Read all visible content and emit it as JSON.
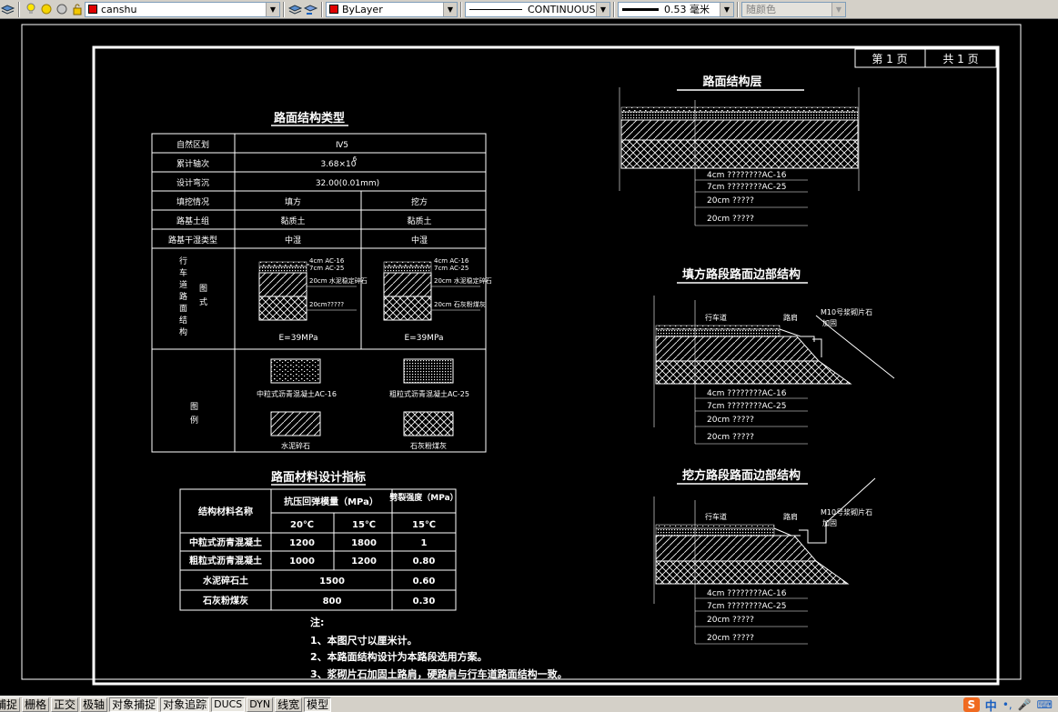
{
  "toolbar": {
    "layer_name": "canshu",
    "color_value": "ByLayer",
    "linetype_value": "CONTINUOUS",
    "lineweight_value": "0.53 毫米",
    "plotstyle_value": "随颜色"
  },
  "title_block": {
    "page": "第 1 页",
    "total": "共 1 页"
  },
  "pavement_type": {
    "title": "路面结构类型",
    "rows": [
      {
        "label": "自然区划",
        "value": "Ⅳ5"
      },
      {
        "label": "累计轴次",
        "value": "3.68×10",
        "sup": "6"
      },
      {
        "label": "设计弯沉",
        "value": "32.00(0.01mm)"
      }
    ],
    "fill_cut": {
      "label": "填挖情况",
      "fill": "填方",
      "cut": "挖方"
    },
    "soil": {
      "label": "路基土组",
      "fill": "黏质土",
      "cut": "黏质土"
    },
    "moisture": {
      "label": "路基干湿类型",
      "fill": "中湿",
      "cut": "中湿"
    },
    "diagram_label_left": "行车道路面结构",
    "diagram_label_right": "图式",
    "layers": [
      "4cm AC-16",
      "7cm AC-25",
      "20cm 水泥稳定碎石",
      "20cm?????"
    ],
    "layers_right": [
      "4cm AC-16",
      "7cm AC-25",
      "20cm 水泥稳定碎石",
      "20cm 石灰粉煤灰"
    ],
    "modulus": "E=39MPa",
    "legend_label": "图例",
    "legend": [
      {
        "name": "中粒式沥青混凝土AC-16"
      },
      {
        "name": "粗粒式沥青混凝土AC-25"
      },
      {
        "name": "水泥碎石"
      },
      {
        "name": "石灰粉煤灰"
      }
    ]
  },
  "material_table": {
    "title": "路面材料设计指标",
    "col_name": "结构材料名称",
    "col_modulus": "抗压回弹模量（MPa）",
    "col_strength": "劈裂强度（MPa）",
    "t20": "20℃",
    "t15": "15℃",
    "t15b": "15℃",
    "rows": [
      {
        "name": "中粒式沥青混凝土",
        "e20": "1200",
        "e15": "1800",
        "s": "1"
      },
      {
        "name": "粗粒式沥青混凝土",
        "e20": "1000",
        "e15": "1200",
        "s": "0.80"
      },
      {
        "name": "水泥碎石土",
        "e20": "1500",
        "s": "0.60"
      },
      {
        "name": "石灰粉煤灰",
        "e20": "800",
        "s": "0.30"
      }
    ]
  },
  "notes": {
    "heading": "注:",
    "items": [
      "1、本图尺寸以厘米计。",
      "2、本路面结构设计为本路段选用方案。",
      "3、浆砌片石加固土路肩，硬路肩与行车道路面结构一致。"
    ]
  },
  "layers_section": {
    "title": "路面结构层",
    "labels": [
      "4cm ????????AC-16",
      "7cm ????????AC-25",
      "20cm ?????",
      "20cm ?????"
    ]
  },
  "fill_edge": {
    "title": "填方路段路面边部结构",
    "lane": "行车道",
    "shoulder": "路肩",
    "callout1": "M10号浆砌片石",
    "callout2": "加固",
    "labels": [
      "4cm ????????AC-16",
      "7cm ????????AC-25",
      "20cm ?????",
      "20cm ?????"
    ]
  },
  "cut_edge": {
    "title": "挖方路段路面边部结构",
    "lane": "行车道",
    "shoulder": "路肩",
    "callout1": "M10号浆砌片石",
    "callout2": "加固",
    "labels": [
      "4cm ????????AC-16",
      "7cm ????????AC-25",
      "20cm ?????",
      "20cm ?????"
    ]
  },
  "statusbar": {
    "buttons": [
      "捕捉",
      "栅格",
      "正交",
      "极轴",
      "对象捕捉",
      "对象追踪",
      "DUCS",
      "DYN",
      "线宽",
      "模型"
    ],
    "on": [
      false,
      false,
      false,
      false,
      true,
      true,
      true,
      false,
      false,
      true
    ],
    "ime_logo": "S",
    "ime_lang": "中"
  }
}
